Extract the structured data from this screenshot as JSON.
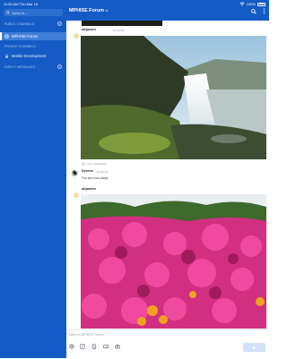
{
  "status_bar": {
    "time": "11:50 AM",
    "date": "Thu Mar 16",
    "battery": "100%"
  },
  "sidebar": {
    "jump_to": "Jump to...",
    "sections": [
      {
        "title": "PUBLIC CHANNELS",
        "channels": [
          {
            "name": "MPHISE Forum",
            "type": "public",
            "active": true
          }
        ]
      },
      {
        "title": "PRIVATE CHANNELS",
        "channels": [
          {
            "name": "Mobile Development",
            "type": "private",
            "active": false
          }
        ]
      },
      {
        "title": "DIRECT MESSAGES",
        "channels": []
      }
    ]
  },
  "header": {
    "channel_title": "MPHISE Forum"
  },
  "posts": [
    {
      "author": "alejandro",
      "time": "10:40 AM",
      "attachment": "waterfall-photo",
      "reaction_note": "Like",
      "thread_note": "Replies/ab"
    },
    {
      "author": "System",
      "time": "10:40 AM",
      "message": "You are now away"
    },
    {
      "author": "alejandro",
      "time": "",
      "attachment": "flowers-photo"
    }
  ],
  "composer": {
    "placeholder": "Write to MPHISE Forum",
    "send_label": ""
  },
  "colors": {
    "brand": "#155bc5",
    "active_item": "#3f7fd9",
    "send_disabled": "#cfe0f8"
  }
}
